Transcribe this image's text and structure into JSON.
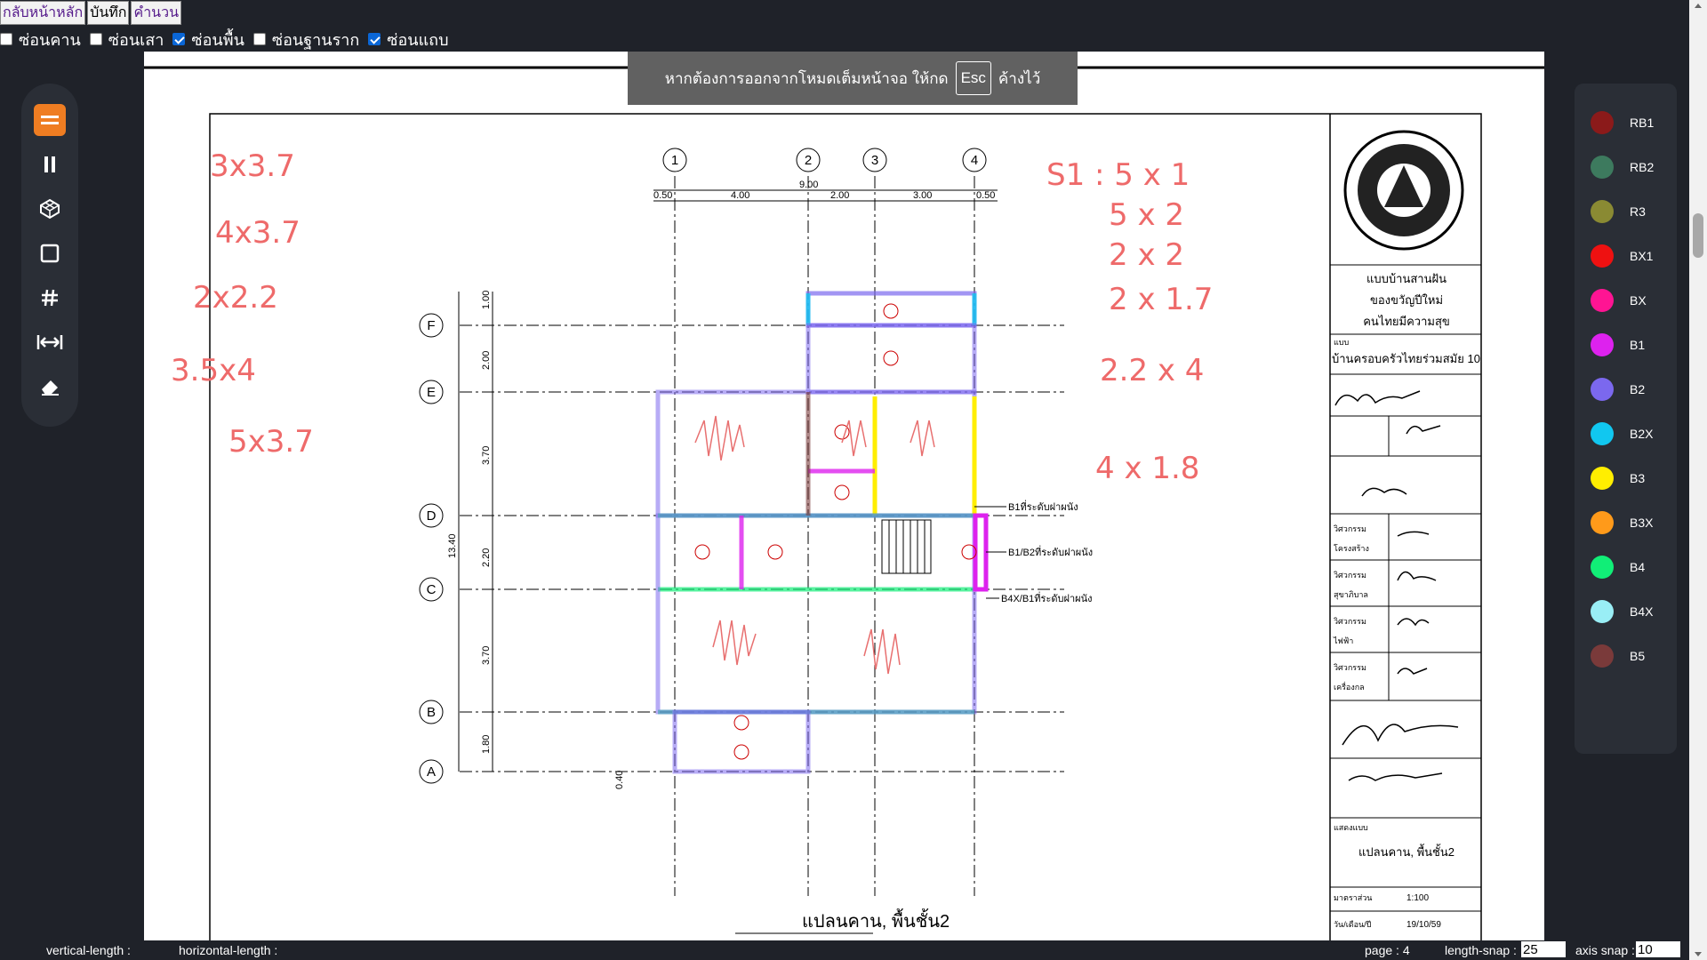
{
  "topbar": {
    "home": "กลับหน้าหลัก",
    "save": "บันทึก",
    "calc": "คำนวน"
  },
  "filters": [
    {
      "label": "ซ่อนคาน",
      "checked": false
    },
    {
      "label": "ซ่อนเสา",
      "checked": false
    },
    {
      "label": "ซ่อนพื้น",
      "checked": true
    },
    {
      "label": "ซ่อนฐานราก",
      "checked": false
    },
    {
      "label": "ซ่อนแถบ",
      "checked": true
    }
  ],
  "toast": {
    "before": "หากต้องการออกจากโหมดเต็มหน้าจอ ให้กด",
    "key": "Esc",
    "after": "ค้างไว้"
  },
  "tools": [
    {
      "name": "menu-icon",
      "active": true
    },
    {
      "name": "column-tool-icon"
    },
    {
      "name": "layers-tool-icon"
    },
    {
      "name": "square-tool-icon"
    },
    {
      "name": "grid-tool-icon"
    },
    {
      "name": "dimension-tool-icon"
    },
    {
      "name": "eraser-tool-icon"
    }
  ],
  "palette": [
    {
      "label": "RB1",
      "color": "#8b1a1a"
    },
    {
      "label": "RB2",
      "color": "#3d7a5e"
    },
    {
      "label": "R3",
      "color": "#8a8a33"
    },
    {
      "label": "BX1",
      "color": "#ee1111"
    },
    {
      "label": "BX",
      "color": "#ff1493"
    },
    {
      "label": "B1",
      "color": "#dd22ee"
    },
    {
      "label": "B2",
      "color": "#7b68ee"
    },
    {
      "label": "B2X",
      "color": "#11c7f0"
    },
    {
      "label": "B3",
      "color": "#ffee00"
    },
    {
      "label": "B3X",
      "color": "#ff9a1a"
    },
    {
      "label": "B4",
      "color": "#11ee77"
    },
    {
      "label": "B4X",
      "color": "#99eef5"
    },
    {
      "label": "B5",
      "color": "#7a3a3a"
    }
  ],
  "drawing": {
    "axes_num": [
      "1",
      "2",
      "3",
      "4"
    ],
    "axes_letter": [
      "F",
      "E",
      "D",
      "C",
      "B",
      "A"
    ],
    "top_dims": [
      "0.50",
      "4.00",
      "2.00",
      "3.00",
      "0.50"
    ],
    "total_top": "9.00",
    "side_dims": [
      "1.00",
      "2.00",
      "3.70",
      "2.20",
      "3.70",
      "1.80",
      "0.40"
    ],
    "total_side": "13.40",
    "caption": "แปลนคาน, พื้นชั้น2",
    "notes_left": [
      "3x3.7",
      "4x3.7",
      "2x2.2",
      "3.5x4",
      "5x3.7"
    ],
    "notes_right": [
      "S1 : 5 x 1",
      "5 x 2",
      "2 x 2",
      "2 x 1.7",
      "2.2 x 4",
      "4 x 1.8"
    ],
    "callouts": [
      "B1ที่ระดับฝาผนัง",
      "B1/B2ที่ระดับฝาผนัง",
      "B4X/B1ที่ระดับฝาผนัง"
    ],
    "title_block": {
      "project": [
        "แบบบ้านสานฝัน",
        "ของขวัญปีใหม่",
        "คนไทยมีความสุข"
      ],
      "type_label": "แบบ",
      "type_value": "บ้านครอบครัวไทยร่วมสมัย 10",
      "rows": [
        "วิศวกรรม",
        "โครงสร้าง",
        "สุขาภิบาล",
        "ไฟฟ้า",
        "เครื่องกล"
      ],
      "sheet_label": "แสดงแบบ",
      "sheet_value": "แปลนคาน, พื้นชั้น2",
      "scale_label": "มาตราส่วน",
      "scale_value": "1:100",
      "date_label": "วัน/เดือน/ปี",
      "date_value": "19/10/59"
    }
  },
  "status": {
    "vlen": "vertical-length :",
    "hlen": "horizontal-length :",
    "page": "page : 4",
    "lsnap_label": "length-snap :",
    "lsnap": "25",
    "asnap_label": "axis snap :",
    "asnap": "10"
  }
}
